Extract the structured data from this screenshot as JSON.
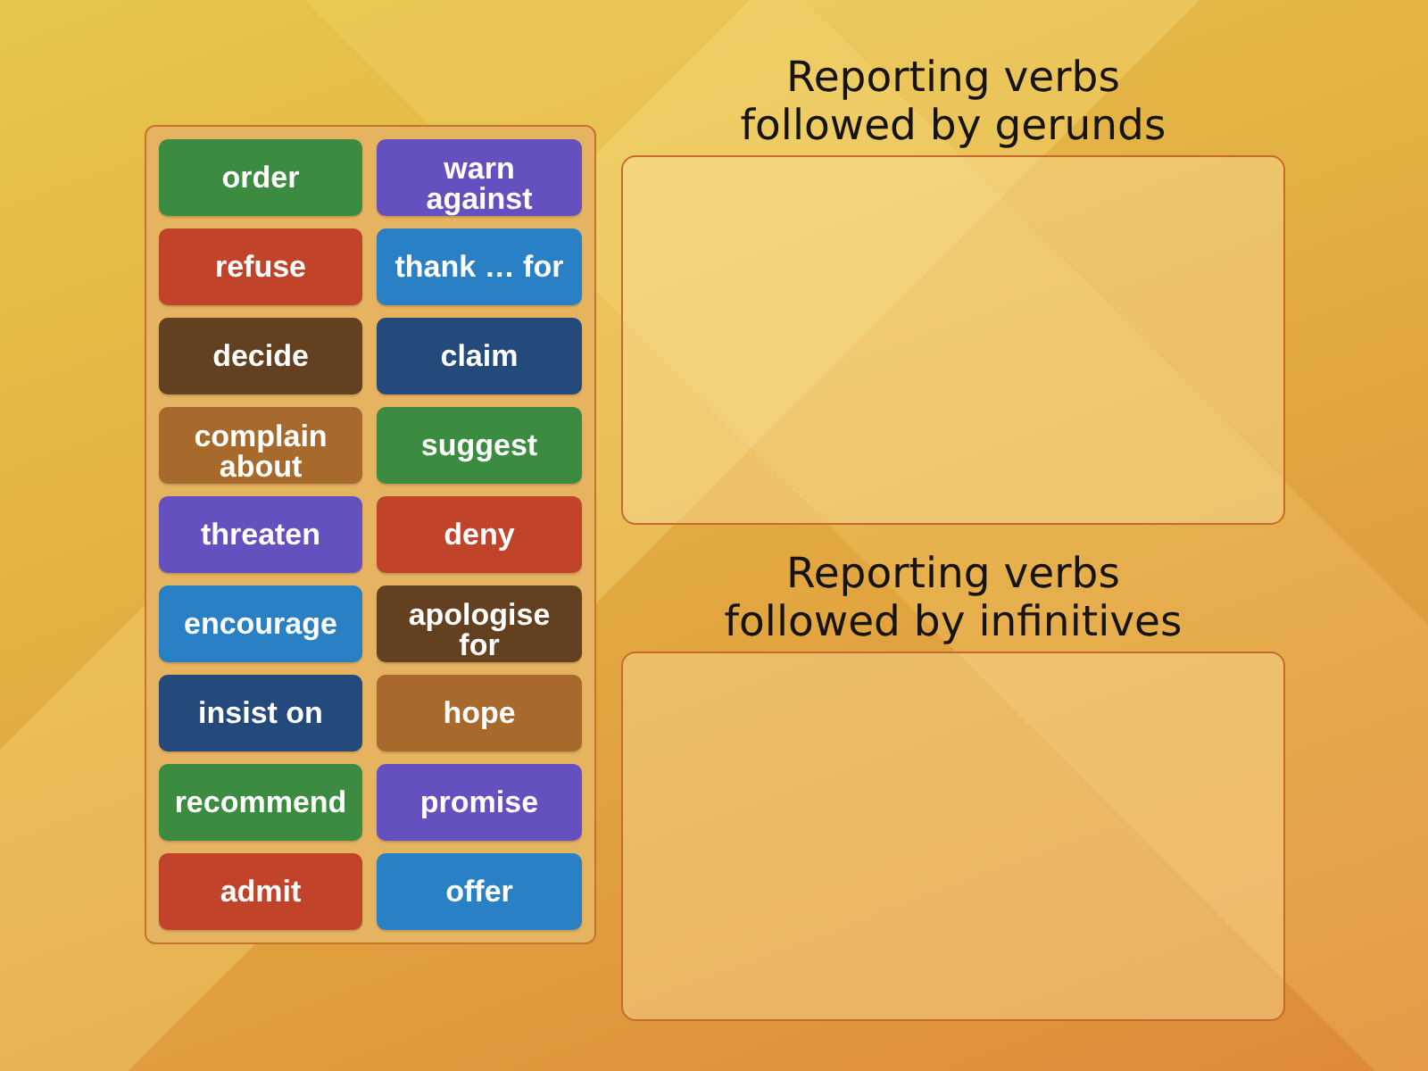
{
  "tiles": [
    {
      "text": "order",
      "color": "#3b8c41"
    },
    {
      "text": "warn against",
      "color": "#6550bf"
    },
    {
      "text": "refuse",
      "color": "#c0432a"
    },
    {
      "text": "thank … for",
      "color": "#2a80c4"
    },
    {
      "text": "decide",
      "color": "#63401f"
    },
    {
      "text": "claim",
      "color": "#234a7a"
    },
    {
      "text": "complain about",
      "color": "#a86a2c"
    },
    {
      "text": "suggest",
      "color": "#3b8c41"
    },
    {
      "text": "threaten",
      "color": "#6550bf"
    },
    {
      "text": "deny",
      "color": "#c0432a"
    },
    {
      "text": "encourage",
      "color": "#2a80c4"
    },
    {
      "text": "apologise for",
      "color": "#63401f"
    },
    {
      "text": "insist on",
      "color": "#234a7a"
    },
    {
      "text": "hope",
      "color": "#a86a2c"
    },
    {
      "text": "recommend",
      "color": "#3b8c41"
    },
    {
      "text": "promise",
      "color": "#6550bf"
    },
    {
      "text": "admit",
      "color": "#c0432a"
    },
    {
      "text": "offer",
      "color": "#2a80c4"
    }
  ],
  "groups": [
    {
      "heading_lines": [
        "Reporting verbs",
        "followed by gerunds"
      ]
    },
    {
      "heading_lines": [
        "Reporting verbs",
        "followed by infinitives"
      ]
    }
  ]
}
